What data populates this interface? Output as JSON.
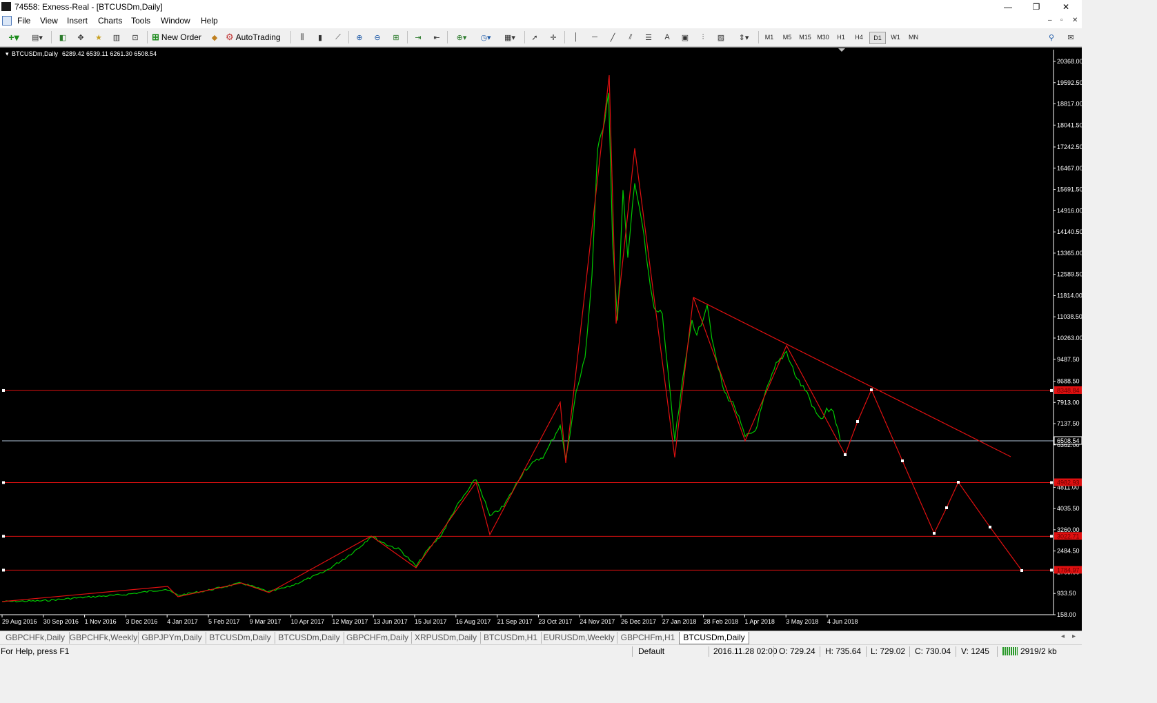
{
  "window": {
    "title": "74558: Exness-Real - [BTCUSDm,Daily]",
    "minimize": "—",
    "restore": "❐",
    "close": "✕"
  },
  "menu": [
    "File",
    "View",
    "Insert",
    "Charts",
    "Tools",
    "Window",
    "Help"
  ],
  "mdi_controls": [
    "–",
    "▫",
    "✕"
  ],
  "toolbar": {
    "new_order": "New Order",
    "autotrading": "AutoTrading",
    "timeframes": [
      "M1",
      "M5",
      "M15",
      "M30",
      "H1",
      "H4",
      "D1",
      "W1",
      "MN"
    ],
    "active_timeframe": "D1"
  },
  "chart": {
    "header": "BTCUSDm,Daily",
    "ohlc": "6289.42 6539.11 6261.30 6508.54",
    "background": "#000000",
    "price_line_color": "#00c800",
    "drawing_color": "#e01010",
    "current_price_line_color": "#b0c4d8",
    "price_axis": [
      "20368.00",
      "19592.50",
      "18817.00",
      "18041.50",
      "17242.50",
      "16467.00",
      "15691.50",
      "14916.00",
      "14140.50",
      "13365.00",
      "12589.50",
      "11814.00",
      "11038.50",
      "10263.00",
      "9487.50",
      "8688.50",
      "7913.00",
      "7137.50",
      "6362.00",
      "4811.00",
      "4035.50",
      "3260.00",
      "2484.50",
      "1709.00",
      "933.50",
      "158.00"
    ],
    "price_labels": [
      {
        "text": "8348.84",
        "kind": "level"
      },
      {
        "text": "6508.54",
        "kind": "current"
      },
      {
        "text": "4982.93",
        "kind": "level"
      },
      {
        "text": "3022.71",
        "kind": "level"
      },
      {
        "text": "1784.97",
        "kind": "level"
      }
    ],
    "time_axis": [
      "29 Aug 2016",
      "30 Sep 2016",
      "1 Nov 2016",
      "3 Dec 2016",
      "4 Jan 2017",
      "5 Feb 2017",
      "9 Mar 2017",
      "10 Apr 2017",
      "12 May 2017",
      "13 Jun 2017",
      "15 Jul 2017",
      "16 Aug 2017",
      "21 Sep 2017",
      "23 Oct 2017",
      "24 Nov 2017",
      "26 Dec 2017",
      "27 Jan 2018",
      "28 Feb 2018",
      "1 Apr 2018",
      "3 May 2018",
      "4 Jun 2018"
    ]
  },
  "tabs": [
    "GBPCHFk,Daily",
    "GBPCHFk,Weekly",
    "GBPJPYm,Daily",
    "BTCUSDm,Daily",
    "BTCUSDm,Daily",
    "GBPCHFm,Daily",
    "XRPUSDm,Daily",
    "BTCUSDm,H1",
    "EURUSDm,Weekly",
    "GBPCHFm,H1",
    "BTCUSDm,Daily"
  ],
  "active_tab_index": 10,
  "status": {
    "help": "For Help, press F1",
    "profile": "Default",
    "datetime": "2016.11.28 02:00",
    "open": "O: 729.24",
    "high": "H: 735.64",
    "low": "L: 729.02",
    "close": "C: 730.04",
    "volume": "V: 1245",
    "traffic": "2919/2 kb"
  }
}
